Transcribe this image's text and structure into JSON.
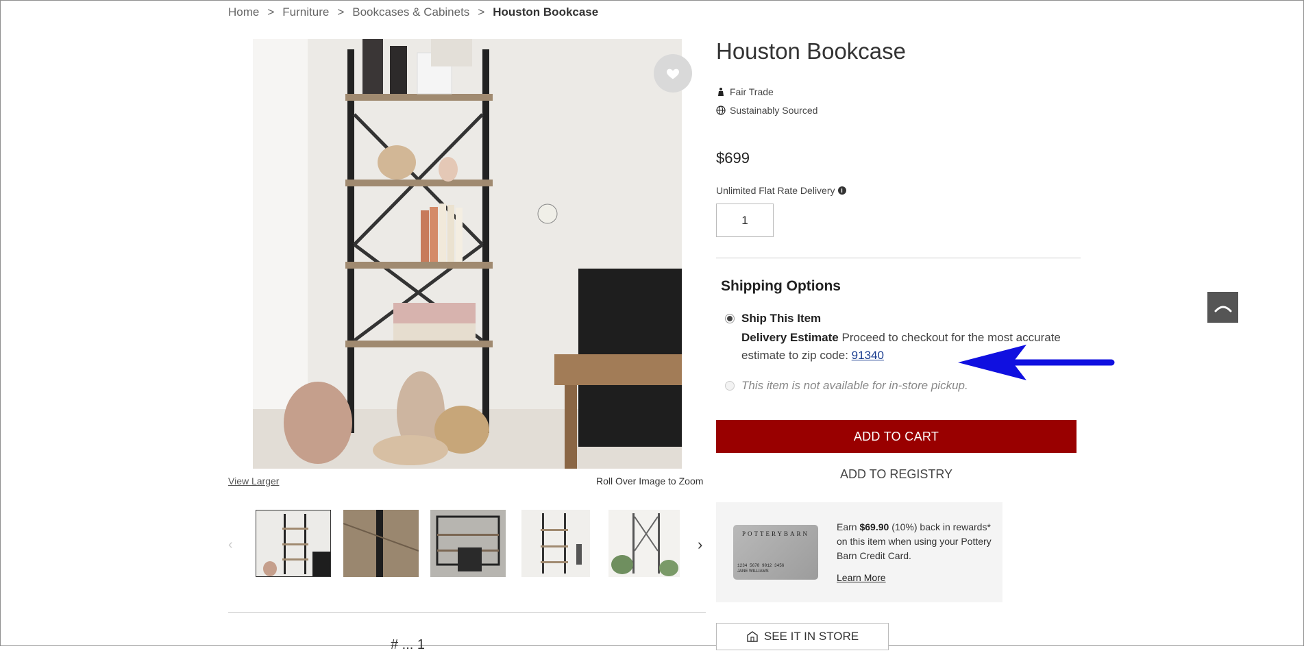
{
  "breadcrumb": {
    "items": [
      "Home",
      "Furniture",
      "Bookcases & Cabinets"
    ],
    "current": "Houston Bookcase",
    "separator": ">"
  },
  "product": {
    "title": "Houston Bookcase",
    "attributes": [
      {
        "label": "Fair Trade",
        "icon": "fair-trade-icon"
      },
      {
        "label": "Sustainably Sourced",
        "icon": "globe-icon"
      }
    ],
    "price": "$699",
    "delivery_label": "Unlimited Flat Rate Delivery",
    "quantity": "1"
  },
  "gallery": {
    "view_larger": "View Larger",
    "zoom_hint": "Roll Over Image to Zoom",
    "thumbnail_count": 5
  },
  "shipping": {
    "title": "Shipping Options",
    "ship_item_label": "Ship This Item",
    "estimate_label": "Delivery Estimate",
    "estimate_text": "Proceed to checkout for the most accurate estimate to zip code:",
    "zip": "91340",
    "pickup_text": "This item is not available for in-store pickup."
  },
  "actions": {
    "add_to_cart": "ADD TO CART",
    "add_to_registry": "ADD TO REGISTRY",
    "see_in_store": "SEE IT IN STORE"
  },
  "rewards": {
    "card_brand": "POTTERYBARN",
    "card_number": "1234 5678 9012 3456",
    "card_holder": "JANE WILLIAMS",
    "text_prefix": "Earn",
    "amount": "$69.90",
    "text_suffix": "(10%) back in rewards* on this item when using your Pottery Barn Credit Card.",
    "learn_more": "Learn More"
  },
  "partial_text": "# ... 1",
  "colors": {
    "add_to_cart_bg": "#990000",
    "annotation_arrow": "#1010e0",
    "link": "#1a3d8f"
  }
}
